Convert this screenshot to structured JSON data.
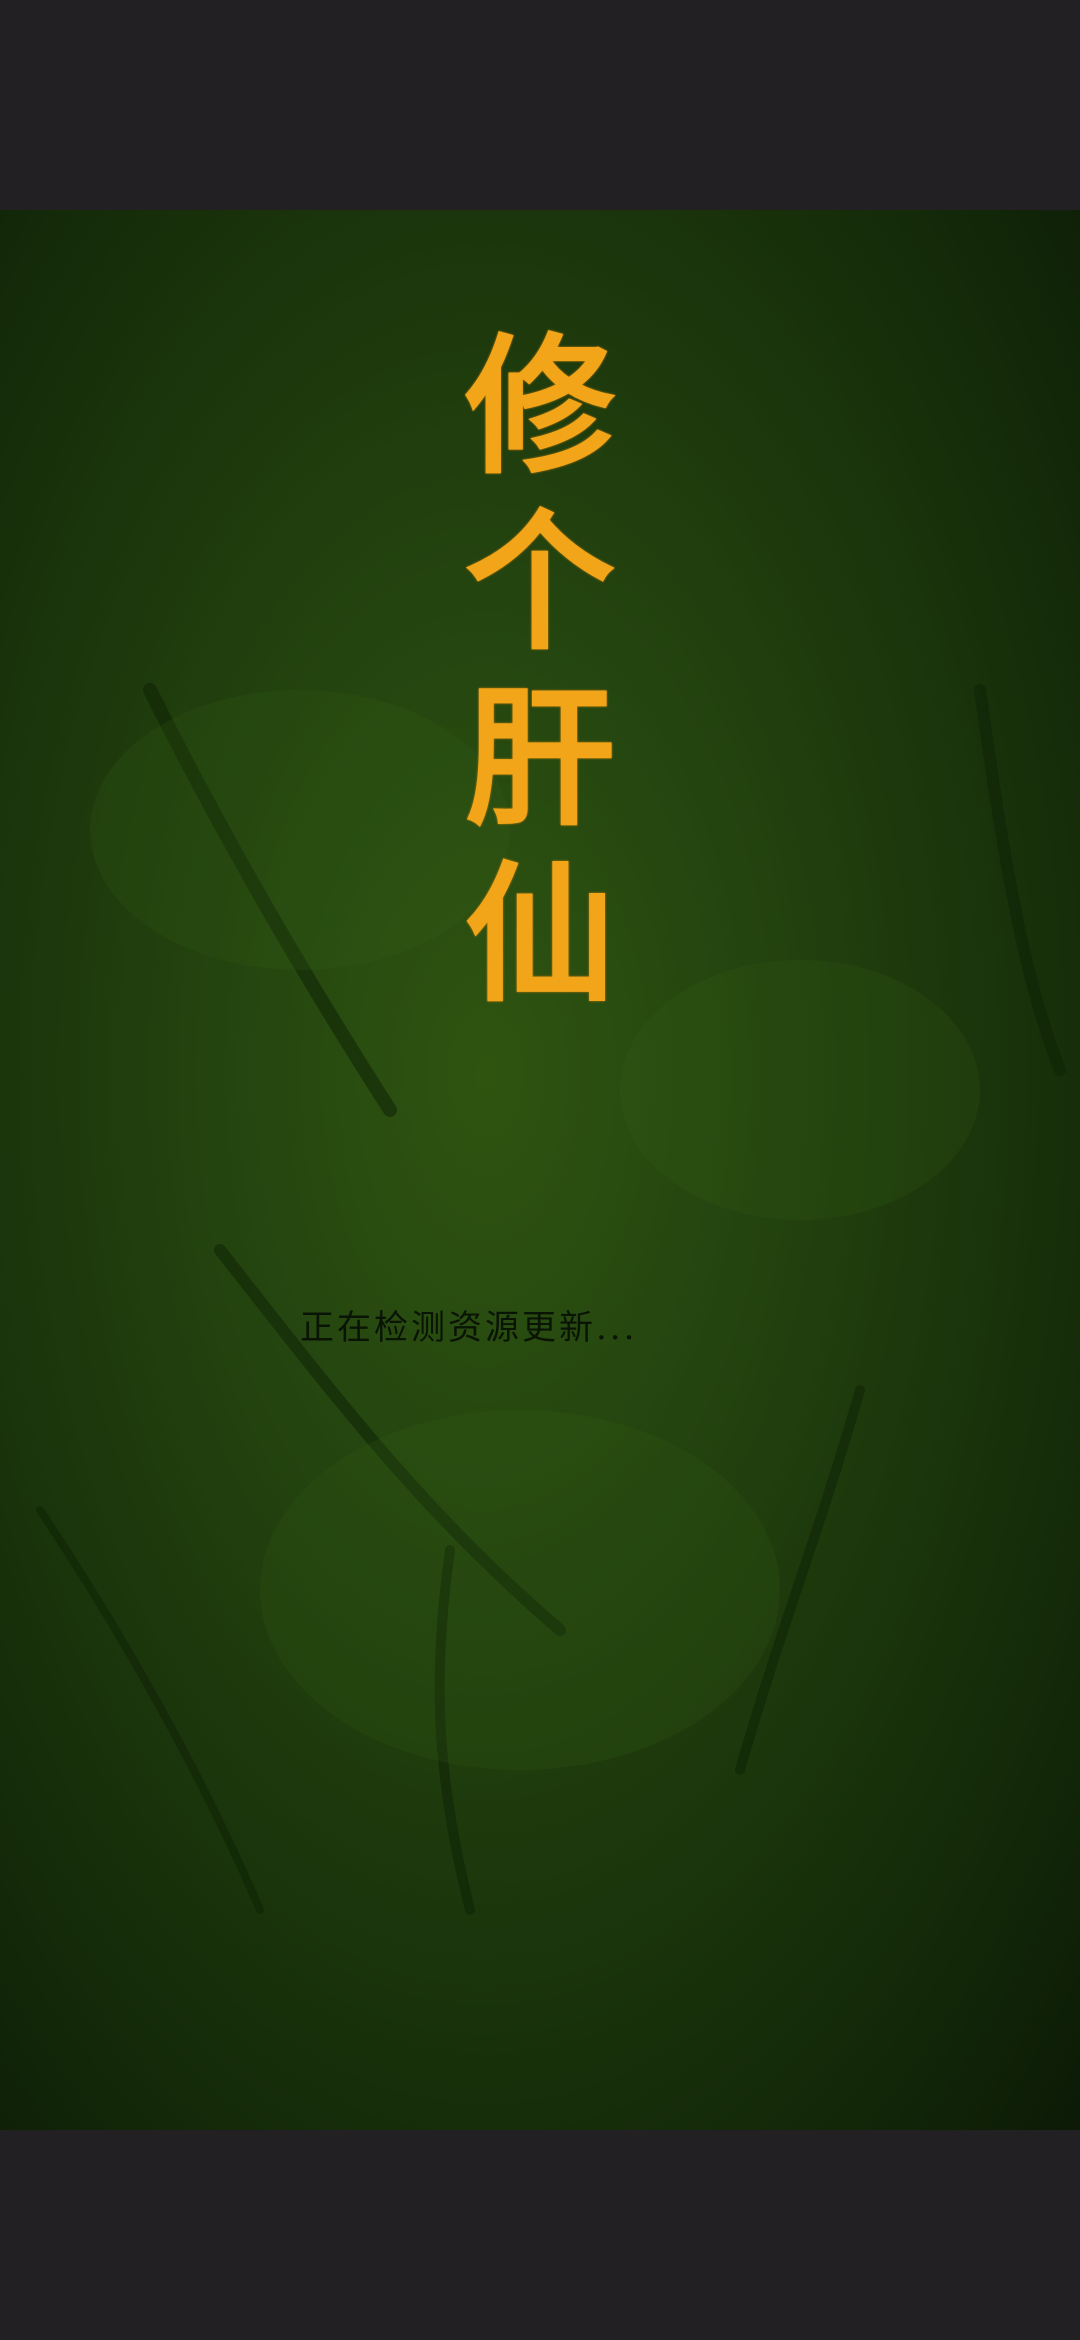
{
  "game": {
    "title_chars": [
      "修",
      "个",
      "肝",
      "仙"
    ],
    "status_text": "正在检测资源更新..."
  },
  "colors": {
    "letterbox": "#232023",
    "title": "#f3a51a",
    "background_center": "#2f5410",
    "background_edge": "#0c1a06",
    "status_text": "#0a1405"
  }
}
